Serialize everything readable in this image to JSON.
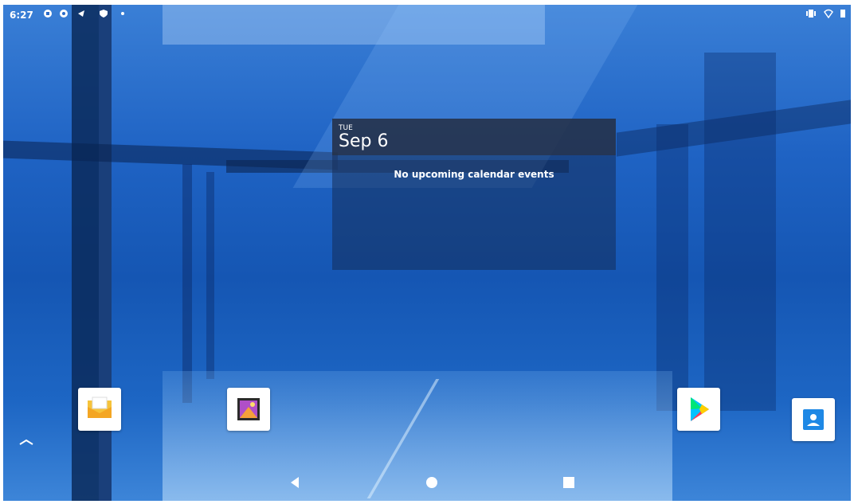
{
  "status_bar": {
    "time": "6:27",
    "left_icons": [
      "sync-icon",
      "settings-icon",
      "navigation-icon",
      "shield-icon",
      "dot-icon"
    ],
    "right_icons": [
      "vibrate-icon",
      "wifi-icon",
      "battery-icon"
    ]
  },
  "calendar_widget": {
    "day": "TUE",
    "date": "Sep 6",
    "empty_message": "No upcoming calendar events"
  },
  "dock": {
    "apps": [
      "email-app-icon",
      "gallery-app-icon",
      "play-store-app-icon",
      "contacts-app-icon"
    ],
    "drawer_icon": "chevron-up-icon"
  },
  "nav_bar": {
    "buttons": [
      "back-icon",
      "home-icon",
      "recents-icon"
    ]
  },
  "colors": {
    "wallpaper": "#1f63c4",
    "widget_bg": "#2b3f63"
  }
}
